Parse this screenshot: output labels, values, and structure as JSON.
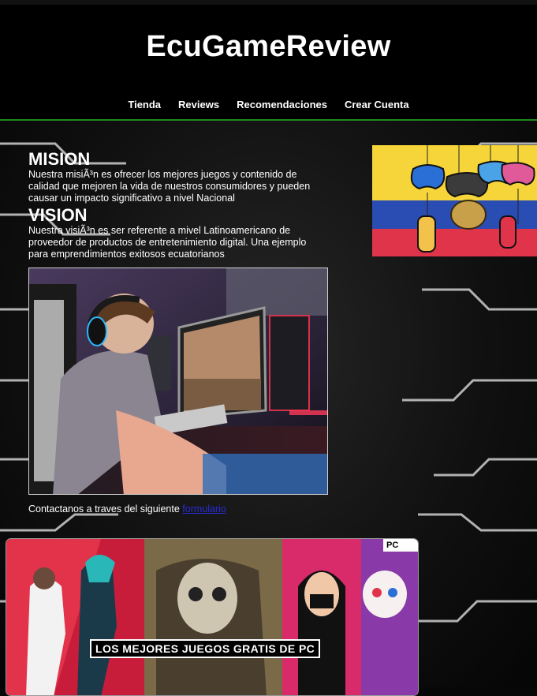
{
  "site": {
    "title": "EcuGameReview"
  },
  "nav": {
    "items": [
      "Tienda",
      "Reviews",
      "Recomendaciones",
      "Crear Cuenta"
    ]
  },
  "mission": {
    "heading": "MISION",
    "text": "Nuestra misiÃ³n es ofrecer los mejores juegos y contenido de calidad que mejoren la vida de nuestros consumidores y pueden causar un impacto significativo a nivel Nacional"
  },
  "vision": {
    "heading": "VISION",
    "text": "Nuestra visiÃ³n es ser referente a mivel Latinoamericano de proveedor de productos de entretenimiento digital. Una ejemplo para emprendimientos exitosos ecuatorianos"
  },
  "contact": {
    "text": "Contactanos a traves del siguiente",
    "link": "formulario"
  },
  "banner": {
    "caption": "LOS MEJORES JUEGOS GRATIS DE PC",
    "corner_badge": "PC"
  },
  "colors": {
    "nav_border": "#1d8a1d",
    "link": "#2a2ad6",
    "accent_neon": "#b7ff3a",
    "accent_blue": "#2ab7ff"
  }
}
